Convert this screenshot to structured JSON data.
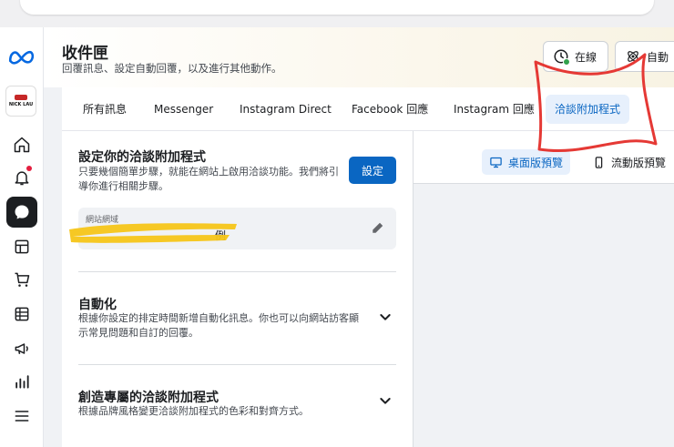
{
  "header": {
    "title": "收件匣",
    "subtitle": "回覆訊息、設定自動回覆，以及進行其他動作。",
    "status_label": "在線",
    "auto_label": "自動"
  },
  "brand": {
    "name": "NICK LAU"
  },
  "tabs": [
    {
      "label": "所有訊息",
      "active": false
    },
    {
      "label": "Messenger",
      "active": false
    },
    {
      "label": "Instagram Direct",
      "active": false
    },
    {
      "label": "Facebook 回應",
      "active": false
    },
    {
      "label": "Instagram 回應",
      "active": false
    },
    {
      "label": "洽談附加程式",
      "active": true
    }
  ],
  "setup": {
    "title": "設定你的洽談附加程式",
    "description": "只要幾個簡單步驟，就能在網站上啟用洽談功能。我們將引導你進行相關步驟。",
    "button_label": "設定",
    "domain_label": "網站網域",
    "domain_value": "",
    "domain_value_visible": "例"
  },
  "sections": [
    {
      "title": "自動化",
      "description": "根據你設定的排定時間新增自動化訊息。你也可以向網站訪客顯示常見問題和自訂的回覆。"
    },
    {
      "title": "創造專屬的洽談附加程式",
      "description": "根據品牌風格變更洽談附加程式的色彩和對齊方式。"
    }
  ],
  "preview": {
    "desktop_label": "桌面版預覽",
    "mobile_label": "流動版預覽"
  },
  "colors": {
    "accent": "#0a66c2",
    "accent_bg": "#e7f0fc",
    "online": "#31a24c",
    "annotation": "#e53935",
    "redaction": "#f5c518"
  }
}
